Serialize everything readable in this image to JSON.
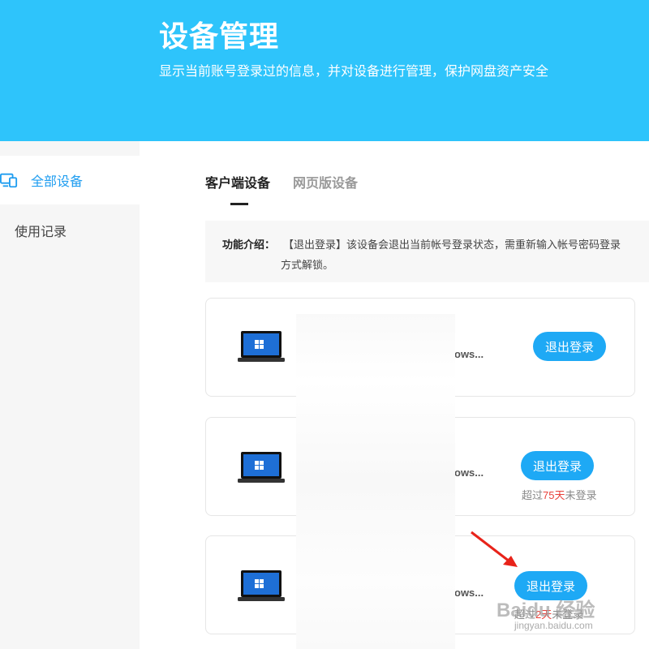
{
  "header": {
    "title": "设备管理",
    "subtitle": "显示当前账号登录过的信息，并对设备进行管理，保护网盘资产安全"
  },
  "sidebar": {
    "items": [
      {
        "label": "全部设备",
        "active": true
      },
      {
        "label": "使用记录",
        "active": false
      }
    ]
  },
  "tabs": [
    {
      "label": "客户端设备",
      "active": true
    },
    {
      "label": "网页版设备",
      "active": false
    }
  ],
  "notice": {
    "title": "功能介绍：",
    "line1": "【退出登录】该设备会退出当前帐号登录状态，需重新输入帐号密码登录",
    "line2": "方式解锁。"
  },
  "devices": [
    {
      "os_fragment": "ows...",
      "button_label": "退出登录",
      "status": ""
    },
    {
      "os_fragment": "ows...",
      "button_label": "退出登录",
      "status_prefix": "超过",
      "status_days": "75天",
      "status_suffix": "未登录"
    },
    {
      "os_fragment": "ows...",
      "button_label": "退出登录",
      "status_prefix": "超过",
      "status_days": "2天",
      "status_suffix": "未登录"
    }
  ],
  "watermark": {
    "text": "Baidu 经验",
    "url": "jingyan.baidu.com"
  },
  "colors": {
    "header_bg": "#2ec4fb",
    "accent": "#1ea9f5",
    "active_nav": "#1f9df0",
    "warning": "#e8423b",
    "arrow": "#e8231a"
  }
}
